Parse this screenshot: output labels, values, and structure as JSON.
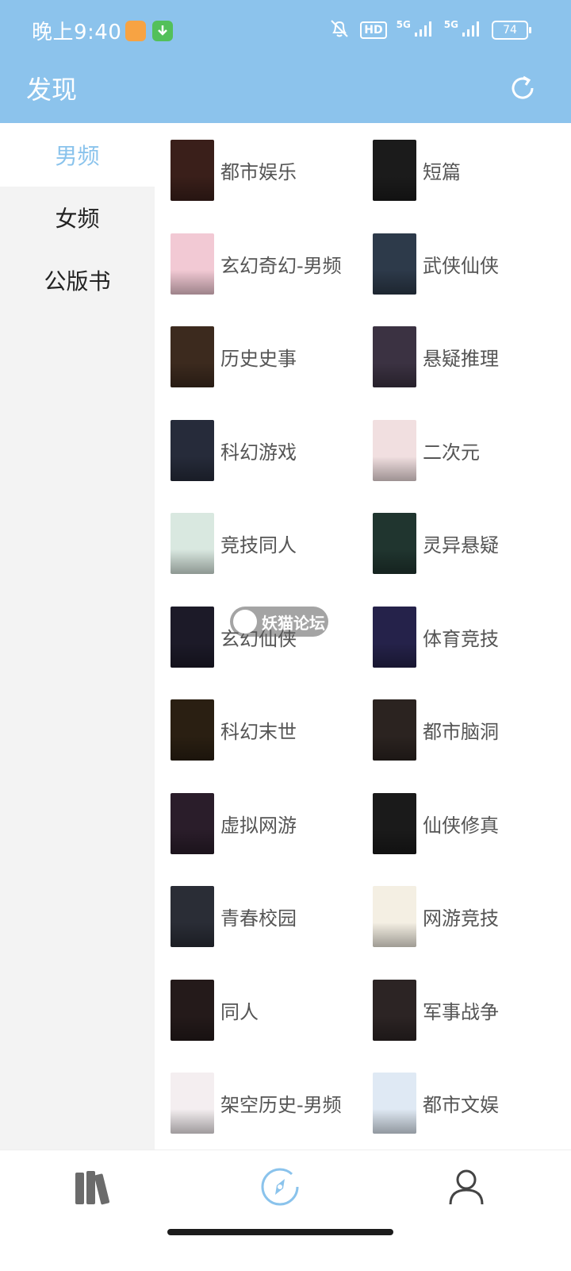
{
  "status_bar": {
    "time": "晚上9:40",
    "hd_label": "HD",
    "net_1": "5G",
    "net_2": "5G",
    "battery": "74"
  },
  "header": {
    "title": "发现",
    "refresh_icon": "refresh-icon"
  },
  "sidebar": {
    "items": [
      {
        "label": "男频",
        "active": true
      },
      {
        "label": "女频",
        "active": false
      },
      {
        "label": "公版书",
        "active": false
      }
    ]
  },
  "categories": [
    {
      "label": "都市娱乐",
      "cover_color": "#3a1f1a"
    },
    {
      "label": "短篇",
      "cover_color": "#1b1b1b"
    },
    {
      "label": "玄幻奇幻-男频",
      "cover_color": "#f2c9d4"
    },
    {
      "label": "武侠仙侠",
      "cover_color": "#2d3a4a"
    },
    {
      "label": "历史史事",
      "cover_color": "#3c2a1e"
    },
    {
      "label": "悬疑推理",
      "cover_color": "#3b3242"
    },
    {
      "label": "科幻游戏",
      "cover_color": "#262b3a"
    },
    {
      "label": "二次元",
      "cover_color": "#f1dfe0"
    },
    {
      "label": "竞技同人",
      "cover_color": "#d9e8e0"
    },
    {
      "label": "灵异悬疑",
      "cover_color": "#20352f"
    },
    {
      "label": "玄幻仙侠",
      "cover_color": "#1c1a28"
    },
    {
      "label": "体育竞技",
      "cover_color": "#25224a"
    },
    {
      "label": "科幻末世",
      "cover_color": "#2a1f12"
    },
    {
      "label": "都市脑洞",
      "cover_color": "#2b2320"
    },
    {
      "label": "虚拟网游",
      "cover_color": "#2a1d2a"
    },
    {
      "label": "仙侠修真",
      "cover_color": "#1a1a1a"
    },
    {
      "label": "青春校园",
      "cover_color": "#2a2d36"
    },
    {
      "label": "网游竞技",
      "cover_color": "#f4efe3"
    },
    {
      "label": "同人",
      "cover_color": "#241a1a"
    },
    {
      "label": "军事战争",
      "cover_color": "#2c2424"
    },
    {
      "label": "架空历史-男频",
      "cover_color": "#f4eef0"
    },
    {
      "label": "都市文娱",
      "cover_color": "#dfe9f4"
    }
  ],
  "watermark": {
    "text": "妖猫论坛"
  },
  "bottom_nav": {
    "items": [
      {
        "icon": "bookshelf-icon"
      },
      {
        "icon": "discover-compass-icon",
        "active": true
      },
      {
        "icon": "profile-icon"
      }
    ]
  },
  "colors": {
    "header_bg": "#8cc3ec",
    "accent": "#8ac3ec",
    "sidebar_bg": "#f3f3f3"
  }
}
